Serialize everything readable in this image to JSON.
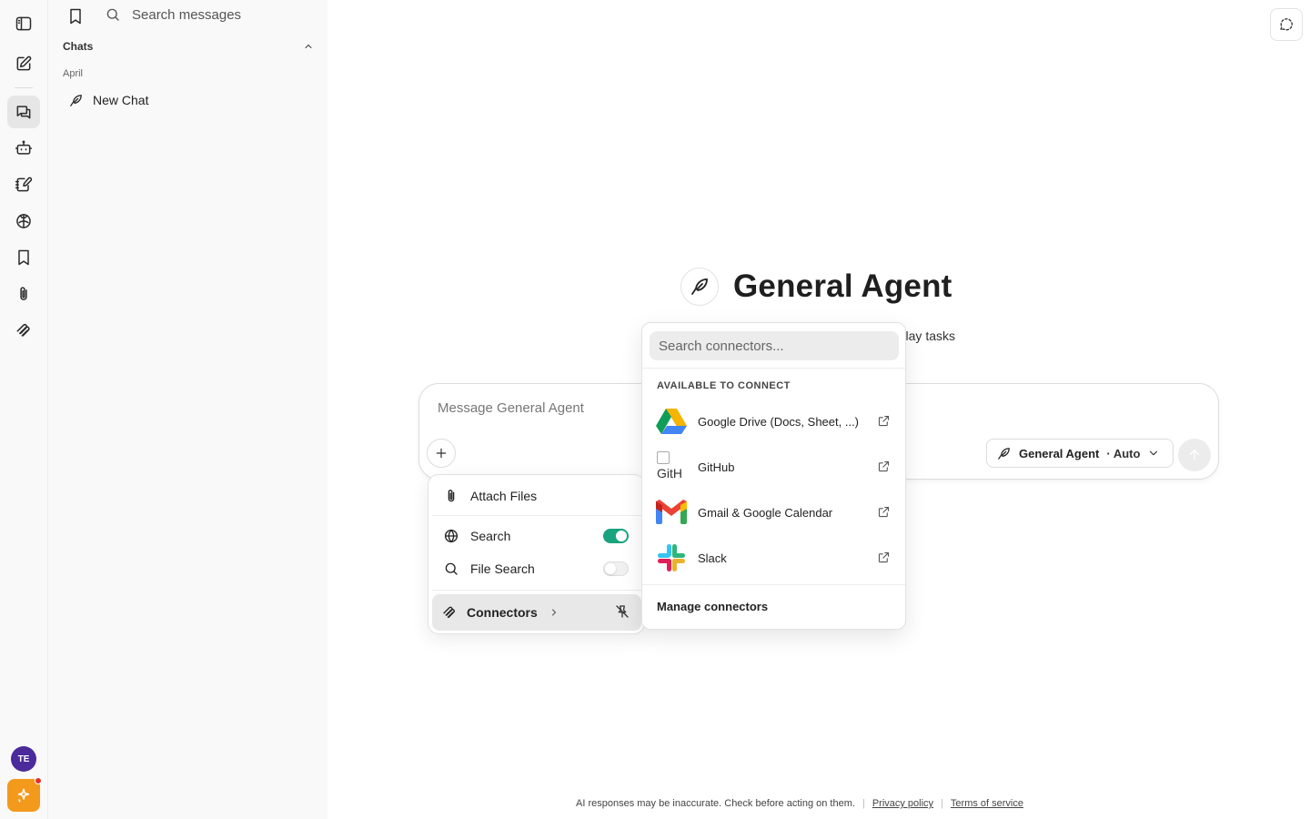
{
  "sidebar": {
    "search_label": "Search messages",
    "section_title": "Chats",
    "month": "April",
    "chats": [
      {
        "title": "New Chat"
      }
    ],
    "user_initials": "TE"
  },
  "main": {
    "agent_title": "General Agent",
    "agent_subtitle_fragment": "lay tasks",
    "composer_placeholder": "Message General Agent",
    "agent_selector": {
      "name": "General Agent",
      "mode": "· Auto"
    }
  },
  "plus_menu": {
    "attach_label": "Attach Files",
    "search_label": "Search",
    "search_enabled": true,
    "file_search_label": "File Search",
    "file_search_enabled": false,
    "connectors_label": "Connectors"
  },
  "connectors_popover": {
    "search_placeholder": "Search connectors...",
    "section_header": "AVAILABLE TO CONNECT",
    "items": [
      {
        "name": "Google Drive (Docs, Sheet, ...)",
        "icon": "google-drive-icon"
      },
      {
        "name": "GitHub",
        "icon": "github-icon",
        "broken_image_alt": "GitH"
      },
      {
        "name": "Gmail & Google Calendar",
        "icon": "gmail-icon"
      },
      {
        "name": "Slack",
        "icon": "slack-icon"
      }
    ],
    "manage_label": "Manage connectors"
  },
  "footer": {
    "disclaimer": "AI responses may be inaccurate. Check before acting on them.",
    "privacy_label": "Privacy policy",
    "terms_label": "Terms of service"
  },
  "colors": {
    "toggle_on": "#1aa37f",
    "avatar_bg": "#4b2a9b",
    "spark_bg": "#f39a1c",
    "notification_dot": "#e5302d"
  }
}
